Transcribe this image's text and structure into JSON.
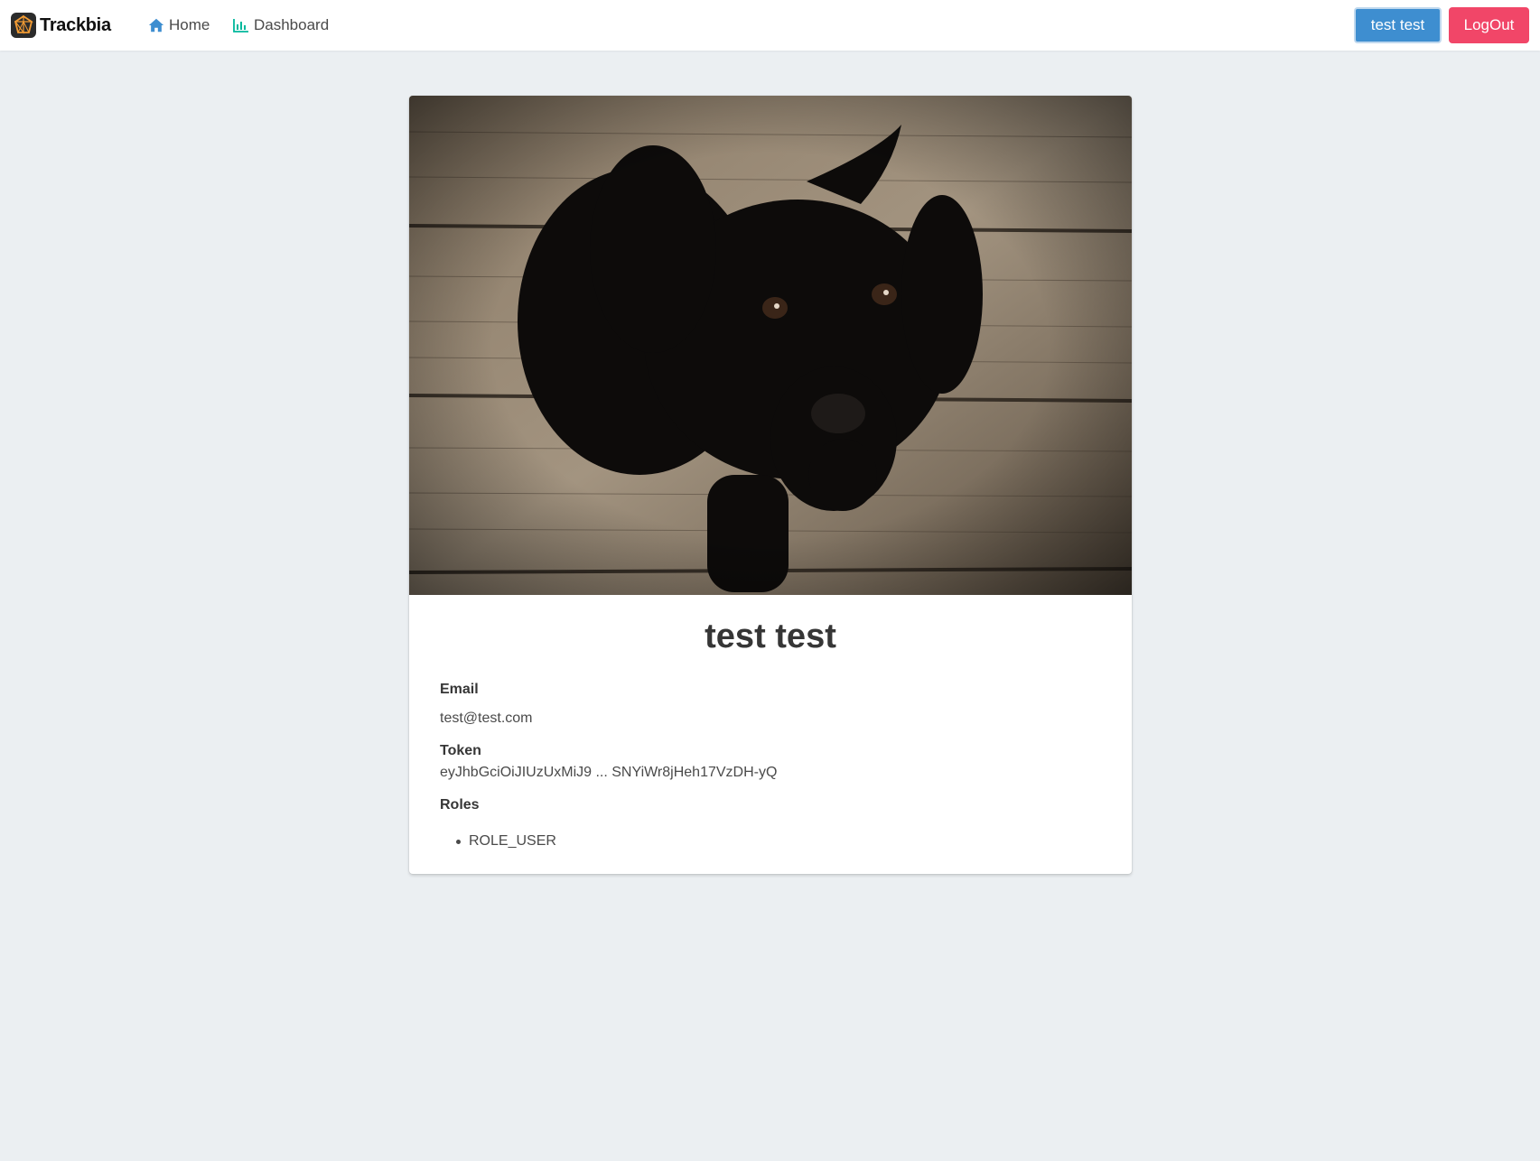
{
  "navbar": {
    "brand": "Trackbia",
    "links": [
      {
        "label": "Home",
        "icon": "home-icon"
      },
      {
        "label": "Dashboard",
        "icon": "bar-chart-icon"
      }
    ],
    "user_button": "test test",
    "logout_button": "LogOut"
  },
  "profile": {
    "name": "test test",
    "email_label": "Email",
    "email": "test@test.com",
    "token_label": "Token",
    "token": "eyJhbGciOiJIUzUxMiJ9 ... SNYiWr8jHeh17VzDH-yQ",
    "roles_label": "Roles",
    "roles": [
      "ROLE_USER"
    ]
  },
  "colors": {
    "page_bg": "#ebeff2",
    "primary": "#3e8ed0",
    "danger": "#f14668",
    "home_icon": "#3e8ed0",
    "dashboard_icon": "#00b89c"
  }
}
